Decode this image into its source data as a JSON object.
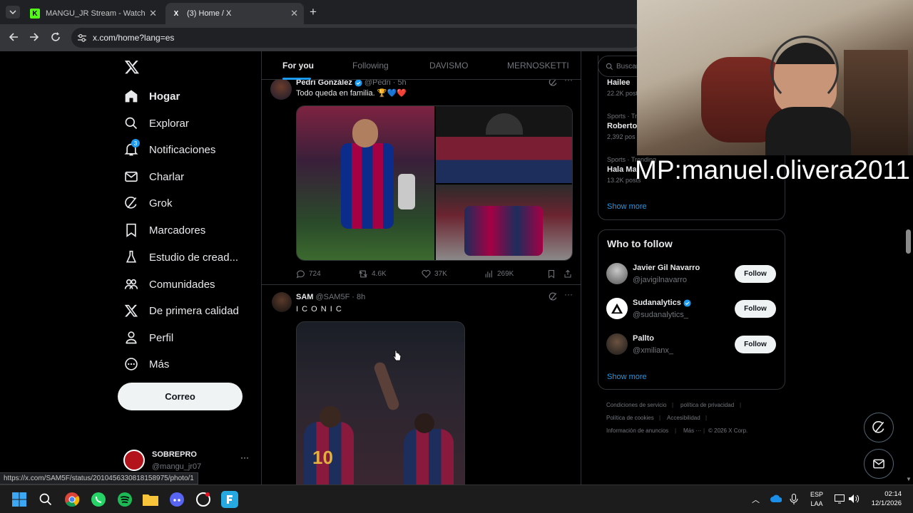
{
  "browser": {
    "tabs": [
      {
        "title": "MANGU_JR Stream - Watch Live",
        "favicon": "K"
      },
      {
        "title": "(3) Home / X",
        "favicon": "X"
      }
    ],
    "new_tab": "+",
    "url": "x.com/home?lang=es",
    "status_url": "https://x.com/SAM5F/status/2010456330818158975/photo/1"
  },
  "nav": {
    "logo": "𝕏",
    "items": [
      {
        "label": "Hogar",
        "icon": "home-icon",
        "active": true
      },
      {
        "label": "Explorar",
        "icon": "search-icon"
      },
      {
        "label": "Notificaciones",
        "icon": "bell-icon",
        "badge": "3"
      },
      {
        "label": "Charlar",
        "icon": "mail-icon"
      },
      {
        "label": "Grok",
        "icon": "grok-icon"
      },
      {
        "label": "Marcadores",
        "icon": "bookmark-icon"
      },
      {
        "label": "Estudio de cread...",
        "icon": "flask-icon"
      },
      {
        "label": "Comunidades",
        "icon": "people-icon"
      },
      {
        "label": "De primera calidad",
        "icon": "x-logo-icon"
      },
      {
        "label": "Perfil",
        "icon": "person-icon"
      },
      {
        "label": "Más",
        "icon": "more-circle-icon"
      }
    ],
    "post_button": "Correo",
    "account": {
      "name": "SOBREPRO",
      "handle": "@mangu_jr07",
      "more": "···"
    }
  },
  "feed": {
    "tabs": [
      "For you",
      "Following",
      "DAVISMO",
      "MERNOSKETTI"
    ],
    "posts": [
      {
        "author": "Pedri González",
        "handle": "@Pedri",
        "time": "· 5h",
        "text": "Todo queda en familia. 🏆💙❤️",
        "stats": {
          "replies": "724",
          "reposts": "4.6K",
          "likes": "37K",
          "views": "269K"
        }
      },
      {
        "author": "SAM",
        "handle": "@SAM5F",
        "time": "· 8h",
        "text": "I C O N I C",
        "jersey_number": "10"
      }
    ]
  },
  "sidebar": {
    "search_placeholder": "Buscar",
    "trends": [
      {
        "category": "",
        "name": "Hailee",
        "posts": "22.2K posts"
      },
      {
        "category": "Sports · Tr",
        "name": "Roberto",
        "posts": "2,392 pos"
      },
      {
        "category": "Sports · Trending",
        "name": "Hala Ma",
        "posts": "13.2K posts"
      }
    ],
    "trends_show_more": "Show more",
    "who_to_follow": {
      "title": "Who to follow",
      "users": [
        {
          "name": "Javier Gil Navarro",
          "handle": "@javigilnavarro",
          "verified": false,
          "button": "Follow"
        },
        {
          "name": "Sudanalytics",
          "handle": "@sudanalytics_",
          "verified": true,
          "button": "Follow"
        },
        {
          "name": "Pallto",
          "handle": "@xmilianx_",
          "verified": false,
          "button": "Follow"
        }
      ],
      "show_more": "Show more"
    },
    "footer": {
      "row1": [
        "Condiciones de servicio",
        "política de privacidad"
      ],
      "row2": [
        "Política de cookies",
        "Accesibilidad"
      ],
      "row3": [
        "Información de anuncios",
        "Más ···",
        "© 2026 X Corp."
      ]
    }
  },
  "overlay": {
    "webcam_text": "MP:manuel.olivera2011"
  },
  "taskbar": {
    "lang_top": "ESP",
    "lang_bottom": "LAA",
    "time": "02:14",
    "date": "12/1/2026"
  },
  "colors": {
    "accent": "#1d9bf0",
    "like": "#f91880",
    "bg": "#000000",
    "border": "#2f3336"
  }
}
